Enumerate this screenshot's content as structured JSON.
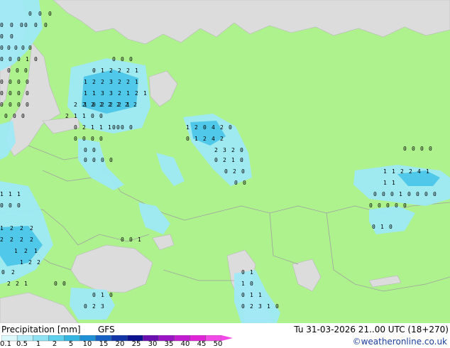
{
  "title": {
    "product_label": "Precipitation [mm]",
    "model_label": "GFS"
  },
  "valid_time": "Tu 31-03-2026 21..00 UTC (18+270)",
  "credit": "©weatheronline.co.uk",
  "colors": {
    "land": "#aef28e",
    "sea": "#dcdcdc",
    "border": "#a0a0a0",
    "precip_light": "#9ee8f5",
    "precip_medium": "#4cc6e8",
    "precip_heavy": "#2aaad6"
  },
  "scale": {
    "labels": [
      "0.1",
      "0.5",
      "1",
      "2",
      "5",
      "10",
      "15",
      "20",
      "25",
      "30",
      "35",
      "40",
      "45",
      "50"
    ],
    "colors": [
      "#dff8fb",
      "#b5eef8",
      "#8ee2f3",
      "#5cd0ec",
      "#35b6e2",
      "#1f8fd6",
      "#1660c4",
      "#1234a8",
      "#0c1290",
      "#6a10b0",
      "#9a14c6",
      "#c21cd2",
      "#e024d8",
      "#f24ae6"
    ]
  },
  "grid_values": [
    [
      "0",
      "0",
      "0"
    ],
    [
      "0",
      "0",
      "0"
    ],
    [
      "0",
      "0",
      "0"
    ],
    [
      "0",
      "0"
    ],
    [
      "0",
      "0",
      "0",
      "0",
      "0"
    ],
    [
      "0",
      "0",
      "0",
      "1",
      "0"
    ],
    [
      "0",
      "0",
      "0"
    ],
    [
      "0",
      "0",
      "0",
      "0"
    ],
    [
      "0",
      "0",
      "0",
      "0"
    ],
    [
      "0",
      "0",
      "0",
      "0"
    ],
    [
      "0",
      "0",
      "0"
    ],
    [
      "0",
      "0",
      "0"
    ],
    [
      "0",
      "1",
      "2",
      "2",
      "2",
      "1"
    ],
    [
      "1",
      "2",
      "2",
      "3",
      "2",
      "2",
      "1"
    ],
    [
      "1",
      "1",
      "3",
      "3",
      "2",
      "1",
      "2",
      "1"
    ],
    [
      "1",
      "0",
      "2",
      "2",
      "2",
      "1"
    ],
    [
      "2",
      "2",
      "2",
      "2",
      "2",
      "2",
      "2",
      "2"
    ],
    [
      "2",
      "1",
      "1",
      "0",
      "0"
    ],
    [
      "0",
      "2",
      "1",
      "1",
      "1",
      "0"
    ],
    [
      "0",
      "0",
      "0"
    ],
    [
      "1",
      "2",
      "0",
      "4",
      "2",
      "0"
    ],
    [
      "0",
      "1",
      "2",
      "4",
      "2"
    ],
    [
      "2",
      "3",
      "2",
      "0"
    ],
    [
      "0",
      "2",
      "1",
      "0"
    ],
    [
      "0",
      "2",
      "0"
    ],
    [
      "0",
      "0"
    ],
    [
      "0",
      "0",
      "0",
      "0"
    ],
    [
      "0",
      "0"
    ],
    [
      "0",
      "0",
      "0",
      "0"
    ],
    [
      "1",
      "1",
      "2",
      "2",
      "4",
      "1"
    ],
    [
      "1",
      "1"
    ],
    [
      "0",
      "0",
      "0",
      "1",
      "0",
      "0",
      "0",
      "0"
    ],
    [
      "0",
      "0",
      "0",
      "0"
    ],
    [
      "0",
      "0",
      "0",
      "0",
      "0"
    ],
    [
      "0",
      "1",
      "0"
    ],
    [
      "1",
      "1",
      "1"
    ],
    [
      "0",
      "0",
      "0"
    ],
    [
      "1",
      "2",
      "2",
      "2"
    ],
    [
      "2",
      "2",
      "2",
      "2"
    ],
    [
      "1",
      "2",
      "1"
    ],
    [
      "1",
      "2",
      "2"
    ],
    [
      "0",
      "2"
    ],
    [
      "2",
      "2",
      "1"
    ],
    [
      "0",
      "0",
      "1"
    ],
    [
      "0",
      "0"
    ],
    [
      "0",
      "1",
      "0"
    ],
    [
      "0",
      "2",
      "3"
    ],
    [
      "0",
      "1"
    ],
    [
      "1",
      "0"
    ],
    [
      "0",
      "1",
      "1"
    ],
    [
      "0",
      "2",
      "3",
      "1",
      "0"
    ]
  ]
}
